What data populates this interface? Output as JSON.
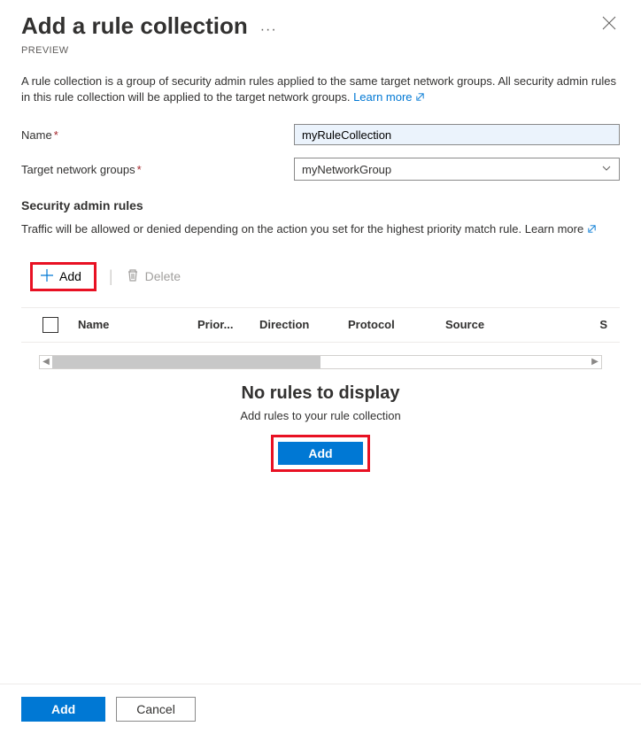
{
  "header": {
    "title": "Add a rule collection",
    "preview": "PREVIEW"
  },
  "description": {
    "text": "A rule collection is a group of security admin rules applied to the same target network groups. All security admin rules in this rule collection will be applied to the target network groups.",
    "learn_more": "Learn more"
  },
  "form": {
    "name_label": "Name",
    "name_value": "myRuleCollection",
    "groups_label": "Target network groups",
    "groups_value": "myNetworkGroup"
  },
  "rules_section": {
    "title": "Security admin rules",
    "desc": "Traffic will be allowed or denied depending on the action you set for the highest priority match rule.",
    "learn_more": "Learn more",
    "toolbar": {
      "add": "Add",
      "delete": "Delete"
    },
    "columns": {
      "name": "Name",
      "priority": "Prior...",
      "direction": "Direction",
      "protocol": "Protocol",
      "source": "Source",
      "source2": "S"
    },
    "empty": {
      "title": "No rules to display",
      "subtitle": "Add rules to your rule collection",
      "button": "Add"
    }
  },
  "footer": {
    "add": "Add",
    "cancel": "Cancel"
  }
}
